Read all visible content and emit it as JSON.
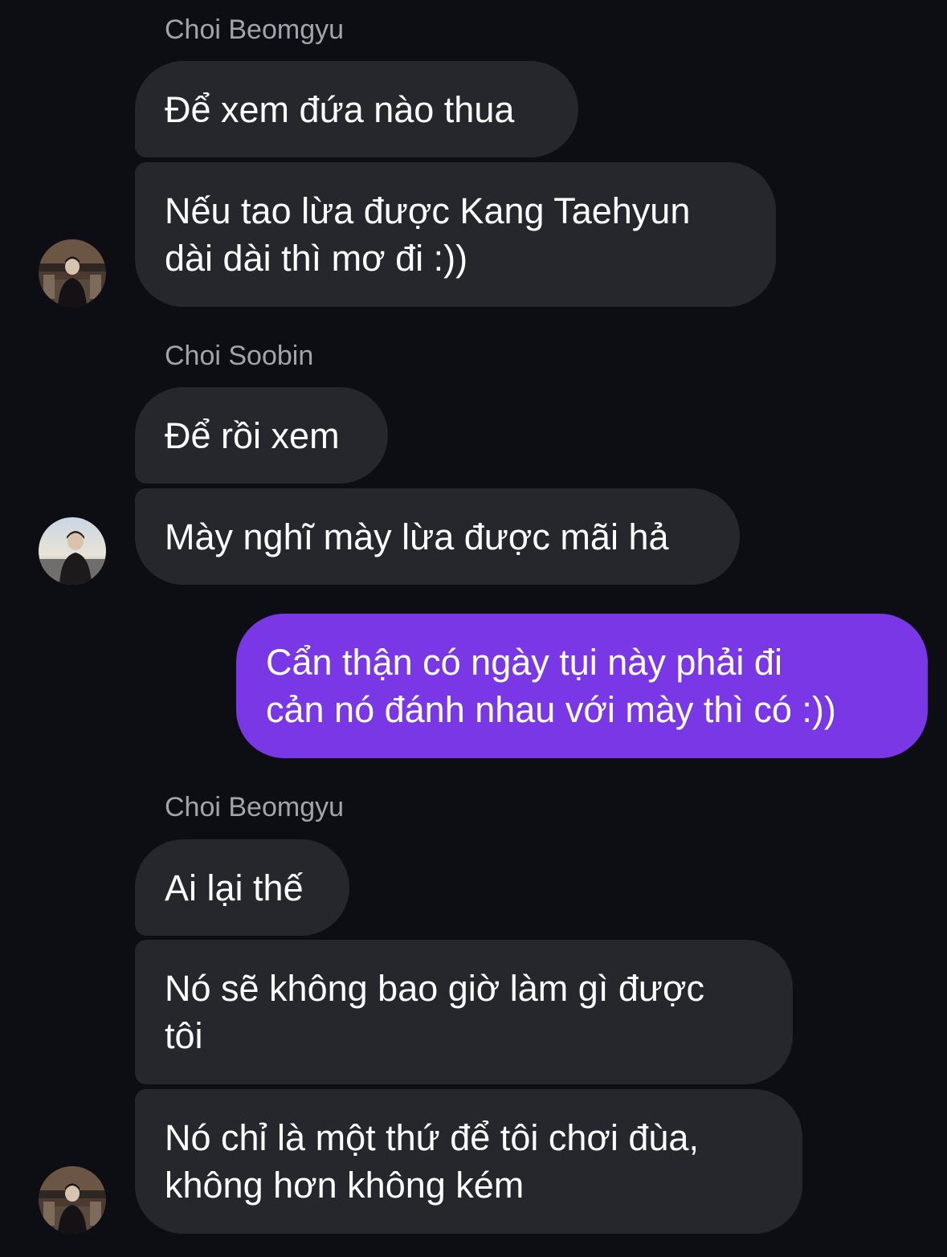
{
  "conversation": {
    "groups": [
      {
        "sender": "Choi Beomgyu",
        "avatar": "person-photo-avatar-beomgyu",
        "messages": [
          {
            "lines": [
              "Để xem đứa nào thua"
            ]
          },
          {
            "lines": [
              "Nếu tao lừa được Kang Taehyun",
              "dài dài thì mơ đi :))"
            ]
          }
        ]
      },
      {
        "sender": "Choi Soobin",
        "avatar": "person-photo-avatar-soobin",
        "messages": [
          {
            "lines": [
              "Để rồi xem"
            ]
          },
          {
            "lines": [
              "Mày nghĩ mày lừa được mãi hả"
            ]
          }
        ]
      },
      {
        "sender": "",
        "outgoing": true,
        "messages": [
          {
            "lines": [
              "Cẩn thận có ngày tụi này phải đi",
              "cản nó đánh nhau với mày thì có :))"
            ]
          }
        ]
      },
      {
        "sender": "Choi Beomgyu",
        "avatar": "person-photo-avatar-beomgyu",
        "messages": [
          {
            "lines": [
              "Ai lại thế"
            ]
          },
          {
            "lines": [
              "Nó sẽ không bao giờ làm gì được",
              "tôi"
            ]
          },
          {
            "lines": [
              "Nó chỉ là một thứ để tôi chơi đùa,",
              "không hơn không kém"
            ]
          }
        ]
      }
    ]
  },
  "colors": {
    "background": "#0d0e13",
    "incoming_bubble": "#25272c",
    "outgoing_bubble": "#7a37e6",
    "sender_name": "#a1a4ab",
    "message_text": "#ffffff"
  }
}
